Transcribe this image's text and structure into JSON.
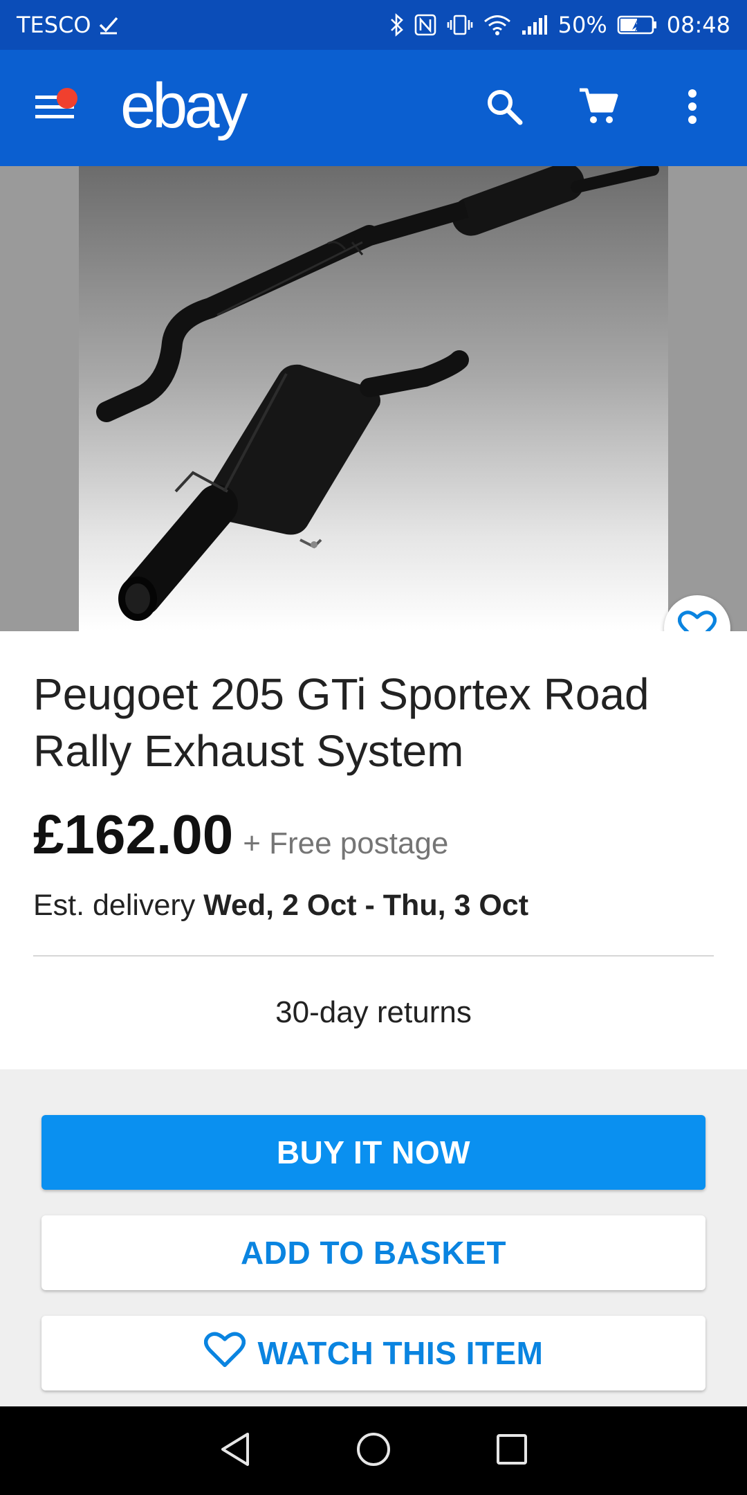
{
  "status_bar": {
    "carrier": "TESCO",
    "battery": "50%",
    "time": "08:48"
  },
  "app_bar": {
    "logo": "ebay"
  },
  "product": {
    "title": "Peugoet 205 GTi Sportex Road Rally Exhaust System",
    "price": "£162.00",
    "postage": "+ Free postage",
    "delivery_prefix": "Est. delivery",
    "delivery_dates": "Wed, 2 Oct - Thu, 3 Oct",
    "returns": "30-day returns"
  },
  "actions": {
    "buy_now": "BUY IT NOW",
    "add_to_basket": "ADD TO BASKET",
    "watch_item": "WATCH THIS ITEM"
  },
  "colors": {
    "status_bar": "#0b4db8",
    "app_bar": "#0b5fd0",
    "primary_button": "#0a90f0",
    "accent_text": "#0a84e0",
    "notification_dot": "#f0402e"
  },
  "icons": {
    "status": [
      "check-icon",
      "bluetooth-icon",
      "nfc-icon",
      "vibrate-icon",
      "wifi-icon",
      "signal-icon",
      "battery-icon"
    ],
    "app_bar": [
      "menu-icon",
      "search-icon",
      "cart-icon",
      "more-vert-icon"
    ],
    "nav": [
      "back-icon",
      "home-icon",
      "recents-icon"
    ]
  }
}
